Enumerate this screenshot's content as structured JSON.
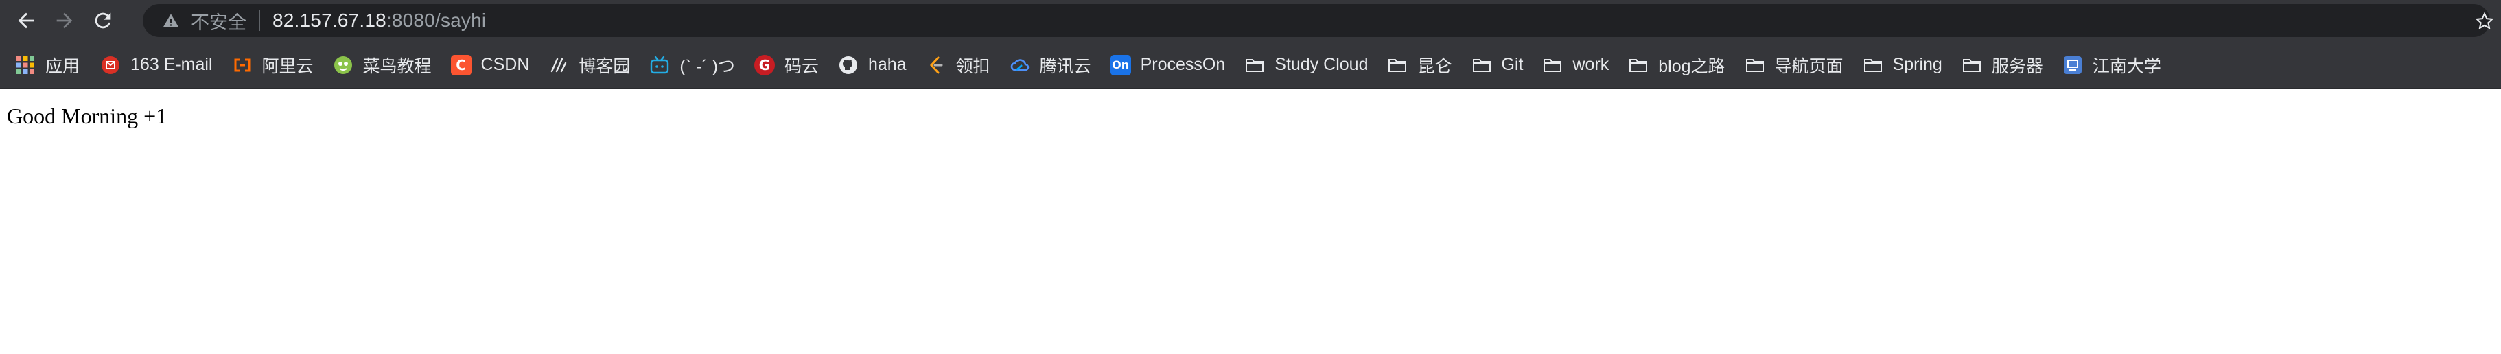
{
  "nav": {
    "back_icon": "arrow-left-icon",
    "forward_icon": "arrow-right-icon",
    "reload_icon": "reload-icon"
  },
  "omnibox": {
    "security_icon": "warning-triangle-icon",
    "security_label": "不安全",
    "url_host": "82.157.67.18",
    "url_rest": ":8080/sayhi",
    "bookmark_icon": "star-icon"
  },
  "bookmarks": {
    "items": [
      {
        "label": "应用",
        "icon": "apps-grid-icon"
      },
      {
        "label": "163 E-mail",
        "icon": "mail-163-icon"
      },
      {
        "label": "阿里云",
        "icon": "aliyun-icon"
      },
      {
        "label": "菜鸟教程",
        "icon": "runoob-icon"
      },
      {
        "label": "CSDN",
        "icon": "csdn-icon"
      },
      {
        "label": "博客园",
        "icon": "cnblogs-icon"
      },
      {
        "label": "(` -´ )つ",
        "icon": "bilibili-icon"
      },
      {
        "label": "码云",
        "icon": "gitee-icon"
      },
      {
        "label": "haha",
        "icon": "github-icon"
      },
      {
        "label": "领扣",
        "icon": "leetcode-icon"
      },
      {
        "label": "腾讯云",
        "icon": "tencent-cloud-icon"
      },
      {
        "label": "ProcessOn",
        "icon": "processon-icon"
      },
      {
        "label": "Study Cloud",
        "icon": "folder-icon"
      },
      {
        "label": "昆仑",
        "icon": "folder-icon"
      },
      {
        "label": "Git",
        "icon": "folder-icon"
      },
      {
        "label": "work",
        "icon": "folder-icon"
      },
      {
        "label": "blog之路",
        "icon": "folder-icon"
      },
      {
        "label": "导航页面",
        "icon": "folder-icon"
      },
      {
        "label": "Spring",
        "icon": "folder-icon"
      },
      {
        "label": "服务器",
        "icon": "folder-icon"
      },
      {
        "label": "江南大学",
        "icon": "jiangnan-icon"
      }
    ]
  },
  "page": {
    "body_text": "Good Morning +1"
  },
  "colors": {
    "toolbar_bg": "#35363a",
    "omnibox_bg": "#202124",
    "text_primary": "#e8eaed",
    "text_secondary": "#9aa0a6",
    "page_bg": "#ffffff"
  }
}
